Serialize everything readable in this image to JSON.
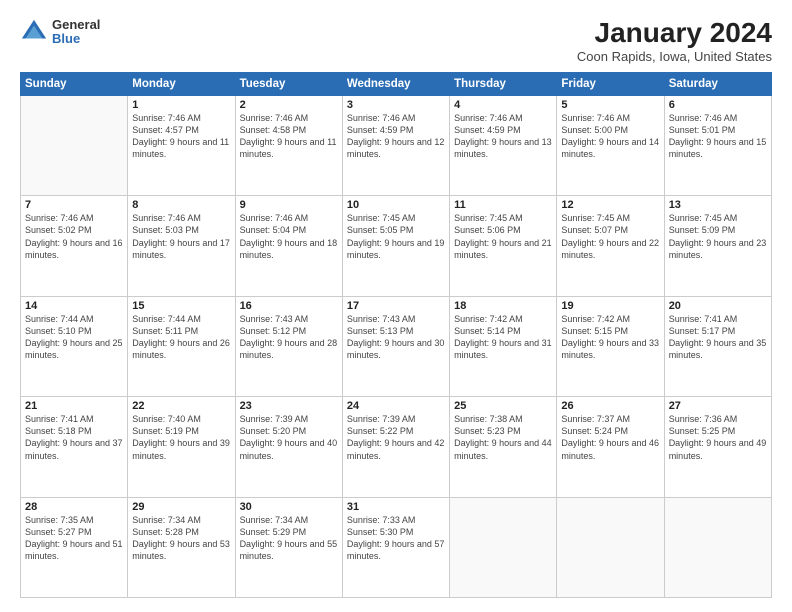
{
  "logo": {
    "general": "General",
    "blue": "Blue"
  },
  "title": "January 2024",
  "location": "Coon Rapids, Iowa, United States",
  "days_of_week": [
    "Sunday",
    "Monday",
    "Tuesday",
    "Wednesday",
    "Thursday",
    "Friday",
    "Saturday"
  ],
  "weeks": [
    [
      {
        "day": "",
        "sunrise": "",
        "sunset": "",
        "daylight": ""
      },
      {
        "day": "1",
        "sunrise": "Sunrise: 7:46 AM",
        "sunset": "Sunset: 4:57 PM",
        "daylight": "Daylight: 9 hours and 11 minutes."
      },
      {
        "day": "2",
        "sunrise": "Sunrise: 7:46 AM",
        "sunset": "Sunset: 4:58 PM",
        "daylight": "Daylight: 9 hours and 11 minutes."
      },
      {
        "day": "3",
        "sunrise": "Sunrise: 7:46 AM",
        "sunset": "Sunset: 4:59 PM",
        "daylight": "Daylight: 9 hours and 12 minutes."
      },
      {
        "day": "4",
        "sunrise": "Sunrise: 7:46 AM",
        "sunset": "Sunset: 4:59 PM",
        "daylight": "Daylight: 9 hours and 13 minutes."
      },
      {
        "day": "5",
        "sunrise": "Sunrise: 7:46 AM",
        "sunset": "Sunset: 5:00 PM",
        "daylight": "Daylight: 9 hours and 14 minutes."
      },
      {
        "day": "6",
        "sunrise": "Sunrise: 7:46 AM",
        "sunset": "Sunset: 5:01 PM",
        "daylight": "Daylight: 9 hours and 15 minutes."
      }
    ],
    [
      {
        "day": "7",
        "sunrise": "Sunrise: 7:46 AM",
        "sunset": "Sunset: 5:02 PM",
        "daylight": "Daylight: 9 hours and 16 minutes."
      },
      {
        "day": "8",
        "sunrise": "Sunrise: 7:46 AM",
        "sunset": "Sunset: 5:03 PM",
        "daylight": "Daylight: 9 hours and 17 minutes."
      },
      {
        "day": "9",
        "sunrise": "Sunrise: 7:46 AM",
        "sunset": "Sunset: 5:04 PM",
        "daylight": "Daylight: 9 hours and 18 minutes."
      },
      {
        "day": "10",
        "sunrise": "Sunrise: 7:45 AM",
        "sunset": "Sunset: 5:05 PM",
        "daylight": "Daylight: 9 hours and 19 minutes."
      },
      {
        "day": "11",
        "sunrise": "Sunrise: 7:45 AM",
        "sunset": "Sunset: 5:06 PM",
        "daylight": "Daylight: 9 hours and 21 minutes."
      },
      {
        "day": "12",
        "sunrise": "Sunrise: 7:45 AM",
        "sunset": "Sunset: 5:07 PM",
        "daylight": "Daylight: 9 hours and 22 minutes."
      },
      {
        "day": "13",
        "sunrise": "Sunrise: 7:45 AM",
        "sunset": "Sunset: 5:09 PM",
        "daylight": "Daylight: 9 hours and 23 minutes."
      }
    ],
    [
      {
        "day": "14",
        "sunrise": "Sunrise: 7:44 AM",
        "sunset": "Sunset: 5:10 PM",
        "daylight": "Daylight: 9 hours and 25 minutes."
      },
      {
        "day": "15",
        "sunrise": "Sunrise: 7:44 AM",
        "sunset": "Sunset: 5:11 PM",
        "daylight": "Daylight: 9 hours and 26 minutes."
      },
      {
        "day": "16",
        "sunrise": "Sunrise: 7:43 AM",
        "sunset": "Sunset: 5:12 PM",
        "daylight": "Daylight: 9 hours and 28 minutes."
      },
      {
        "day": "17",
        "sunrise": "Sunrise: 7:43 AM",
        "sunset": "Sunset: 5:13 PM",
        "daylight": "Daylight: 9 hours and 30 minutes."
      },
      {
        "day": "18",
        "sunrise": "Sunrise: 7:42 AM",
        "sunset": "Sunset: 5:14 PM",
        "daylight": "Daylight: 9 hours and 31 minutes."
      },
      {
        "day": "19",
        "sunrise": "Sunrise: 7:42 AM",
        "sunset": "Sunset: 5:15 PM",
        "daylight": "Daylight: 9 hours and 33 minutes."
      },
      {
        "day": "20",
        "sunrise": "Sunrise: 7:41 AM",
        "sunset": "Sunset: 5:17 PM",
        "daylight": "Daylight: 9 hours and 35 minutes."
      }
    ],
    [
      {
        "day": "21",
        "sunrise": "Sunrise: 7:41 AM",
        "sunset": "Sunset: 5:18 PM",
        "daylight": "Daylight: 9 hours and 37 minutes."
      },
      {
        "day": "22",
        "sunrise": "Sunrise: 7:40 AM",
        "sunset": "Sunset: 5:19 PM",
        "daylight": "Daylight: 9 hours and 39 minutes."
      },
      {
        "day": "23",
        "sunrise": "Sunrise: 7:39 AM",
        "sunset": "Sunset: 5:20 PM",
        "daylight": "Daylight: 9 hours and 40 minutes."
      },
      {
        "day": "24",
        "sunrise": "Sunrise: 7:39 AM",
        "sunset": "Sunset: 5:22 PM",
        "daylight": "Daylight: 9 hours and 42 minutes."
      },
      {
        "day": "25",
        "sunrise": "Sunrise: 7:38 AM",
        "sunset": "Sunset: 5:23 PM",
        "daylight": "Daylight: 9 hours and 44 minutes."
      },
      {
        "day": "26",
        "sunrise": "Sunrise: 7:37 AM",
        "sunset": "Sunset: 5:24 PM",
        "daylight": "Daylight: 9 hours and 46 minutes."
      },
      {
        "day": "27",
        "sunrise": "Sunrise: 7:36 AM",
        "sunset": "Sunset: 5:25 PM",
        "daylight": "Daylight: 9 hours and 49 minutes."
      }
    ],
    [
      {
        "day": "28",
        "sunrise": "Sunrise: 7:35 AM",
        "sunset": "Sunset: 5:27 PM",
        "daylight": "Daylight: 9 hours and 51 minutes."
      },
      {
        "day": "29",
        "sunrise": "Sunrise: 7:34 AM",
        "sunset": "Sunset: 5:28 PM",
        "daylight": "Daylight: 9 hours and 53 minutes."
      },
      {
        "day": "30",
        "sunrise": "Sunrise: 7:34 AM",
        "sunset": "Sunset: 5:29 PM",
        "daylight": "Daylight: 9 hours and 55 minutes."
      },
      {
        "day": "31",
        "sunrise": "Sunrise: 7:33 AM",
        "sunset": "Sunset: 5:30 PM",
        "daylight": "Daylight: 9 hours and 57 minutes."
      },
      {
        "day": "",
        "sunrise": "",
        "sunset": "",
        "daylight": ""
      },
      {
        "day": "",
        "sunrise": "",
        "sunset": "",
        "daylight": ""
      },
      {
        "day": "",
        "sunrise": "",
        "sunset": "",
        "daylight": ""
      }
    ]
  ]
}
